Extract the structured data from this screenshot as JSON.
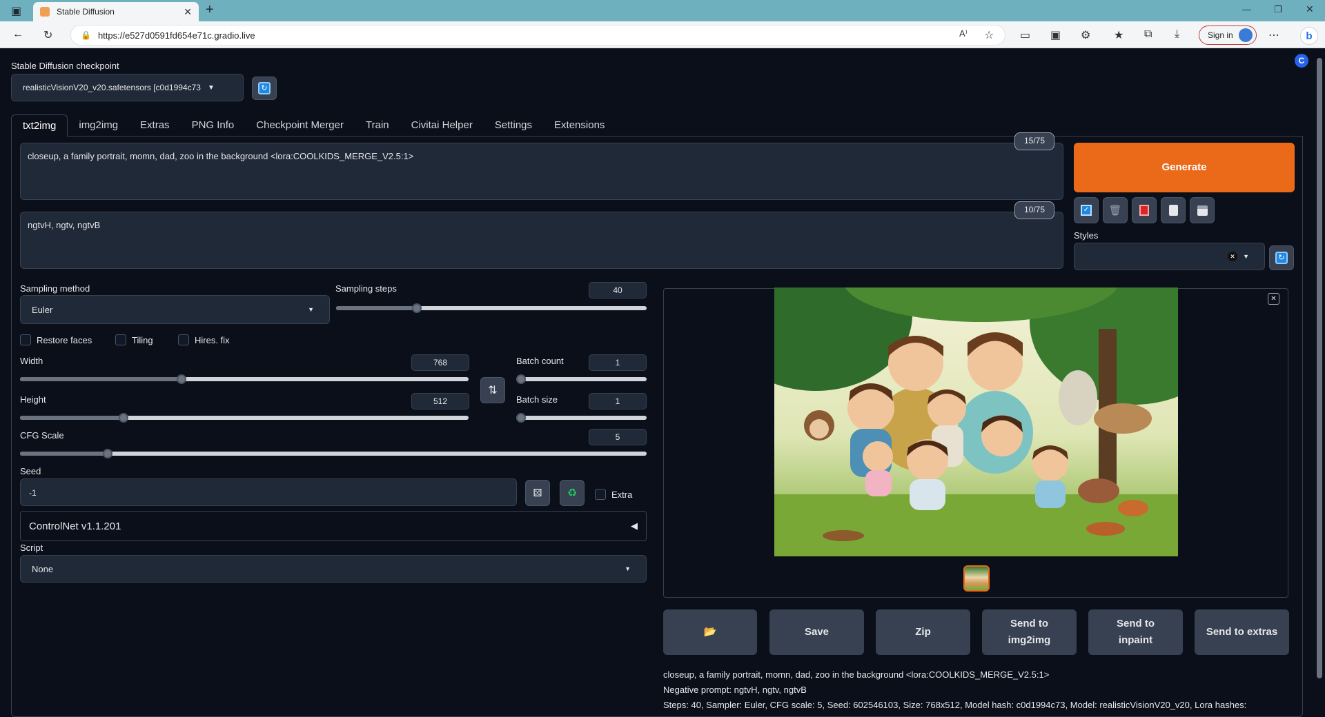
{
  "browser": {
    "tab_title": "Stable Diffusion",
    "url": "https://e527d0591fd654e71c.gradio.live",
    "sign_in": "Sign in"
  },
  "checkpoint": {
    "label": "Stable Diffusion checkpoint",
    "value": "realisticVisionV20_v20.safetensors [c0d1994c73"
  },
  "tabs": [
    "txt2img",
    "img2img",
    "Extras",
    "PNG Info",
    "Checkpoint Merger",
    "Train",
    "Civitai Helper",
    "Settings",
    "Extensions"
  ],
  "prompt": {
    "text": "closeup, a family portrait, momn, dad, zoo in the background  <lora:COOLKIDS_MERGE_V2.5:1>",
    "counter": "15/75"
  },
  "negative_prompt": {
    "text": "ngtvH, ngtv, ngtvB",
    "counter": "10/75"
  },
  "generate_label": "Generate",
  "styles_label": "Styles",
  "sampling": {
    "method_label": "Sampling method",
    "method_value": "Euler",
    "steps_label": "Sampling steps",
    "steps_value": "40",
    "steps_fraction": 0.26
  },
  "checkboxes": {
    "restore_faces": "Restore faces",
    "tiling": "Tiling",
    "hires_fix": "Hires. fix"
  },
  "width": {
    "label": "Width",
    "value": "768",
    "fraction": 0.36
  },
  "height": {
    "label": "Height",
    "value": "512",
    "fraction": 0.23
  },
  "batch_count": {
    "label": "Batch count",
    "value": "1"
  },
  "batch_size": {
    "label": "Batch size",
    "value": "1"
  },
  "cfg": {
    "label": "CFG Scale",
    "value": "5",
    "fraction": 0.14
  },
  "seed": {
    "label": "Seed",
    "value": "-1",
    "extra_label": "Extra"
  },
  "controlnet_label": "ControlNet v1.1.201",
  "script": {
    "label": "Script",
    "value": "None"
  },
  "actions": {
    "folder": "📂",
    "save": "Save",
    "zip": "Zip",
    "send_img2img": "Send to img2img",
    "send_inpaint": "Send to inpaint",
    "send_extras": "Send to extras"
  },
  "info": {
    "line1": "closeup, a family portrait, momn, dad, zoo in the background <lora:COOLKIDS_MERGE_V2.5:1>",
    "line2": "Negative prompt: ngtvH, ngtv, ngtvB",
    "line3": "Steps: 40, Sampler: Euler, CFG scale: 5, Seed: 602546103, Size: 768x512, Model hash: c0d1994c73, Model: realisticVisionV20_v20, Lora hashes:"
  },
  "colors": {
    "accent": "#ea6a1a",
    "background": "#0b0f19",
    "panel": "#1f2937"
  }
}
